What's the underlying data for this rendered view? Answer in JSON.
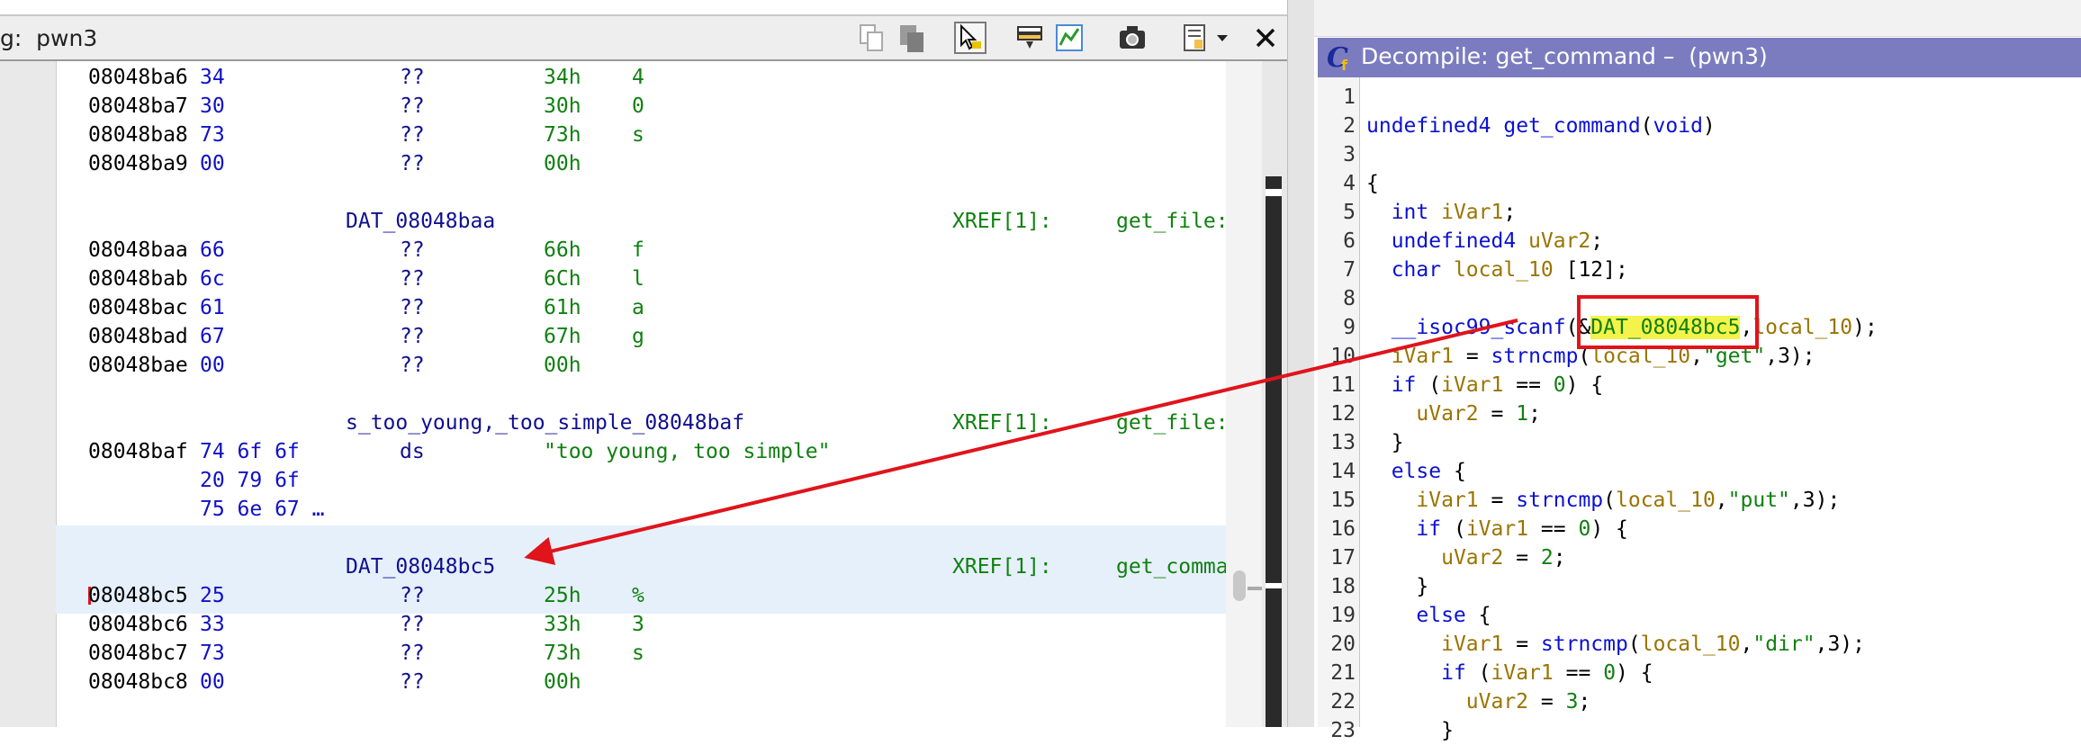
{
  "listing": {
    "title": "g:  pwn3",
    "rows": [
      {
        "addr": "08048ba6",
        "bytes": "34",
        "mn": "??",
        "op": "34h",
        "ch": "4"
      },
      {
        "addr": "08048ba7",
        "bytes": "30",
        "mn": "??",
        "op": "30h",
        "ch": "0"
      },
      {
        "addr": "08048ba8",
        "bytes": "73",
        "mn": "??",
        "op": "73h",
        "ch": "s"
      },
      {
        "addr": "08048ba9",
        "bytes": "00",
        "mn": "??",
        "op": "00h",
        "ch": ""
      }
    ],
    "label1": {
      "name": "DAT_08048baa",
      "xref": "XREF[1]:",
      "xref_fn": "get_file:"
    },
    "rows2": [
      {
        "addr": "08048baa",
        "bytes": "66",
        "mn": "??",
        "op": "66h",
        "ch": "f"
      },
      {
        "addr": "08048bab",
        "bytes": "6c",
        "mn": "??",
        "op": "6Ch",
        "ch": "l"
      },
      {
        "addr": "08048bac",
        "bytes": "61",
        "mn": "??",
        "op": "61h",
        "ch": "a"
      },
      {
        "addr": "08048bad",
        "bytes": "67",
        "mn": "??",
        "op": "67h",
        "ch": "g"
      },
      {
        "addr": "08048bae",
        "bytes": "00",
        "mn": "??",
        "op": "00h",
        "ch": ""
      }
    ],
    "label2": {
      "name": "s_too_young,_too_simple_08048baf",
      "xref": "XREF[1]:",
      "xref_fn": "get_file:"
    },
    "string_row": {
      "addr": "08048baf",
      "bytes": "74 6f 6f",
      "mn": "ds",
      "op": "\"too young, too simple\""
    },
    "string_cont1": "20 79 6f",
    "string_cont2": "75 6e 67 …",
    "label3": {
      "name": "DAT_08048bc5",
      "xref": "XREF[1]:",
      "xref_fn": "get_comma"
    },
    "rows3": [
      {
        "addr": "08048bc5",
        "bytes": "25",
        "mn": "??",
        "op": "25h",
        "ch": "%"
      },
      {
        "addr": "08048bc6",
        "bytes": "33",
        "mn": "??",
        "op": "33h",
        "ch": "3"
      },
      {
        "addr": "08048bc7",
        "bytes": "73",
        "mn": "??",
        "op": "73h",
        "ch": "s"
      },
      {
        "addr": "08048bc8",
        "bytes": "00",
        "mn": "??",
        "op": "00h",
        "ch": ""
      }
    ]
  },
  "decompile": {
    "title": "Decompile: get_command –  (pwn3)",
    "lines": [
      "1",
      "2",
      "3",
      "4",
      "5",
      "6",
      "7",
      "8",
      "9",
      "10",
      "11",
      "12",
      "13",
      "14",
      "15",
      "16",
      "17",
      "18",
      "19",
      "20",
      "21",
      "22",
      "23"
    ]
  },
  "colors": {
    "accent": "#e0141b",
    "titlebar": "#7b7cc0",
    "highlight": "#f3f34a"
  },
  "icons": [
    "copy-icon",
    "paste-icon",
    "cursor-select-icon",
    "listing-fields-icon",
    "diff-icon",
    "snapshot-icon",
    "columns-icon",
    "dropdown-icon",
    "close-icon",
    "decompiler-logo-icon"
  ]
}
